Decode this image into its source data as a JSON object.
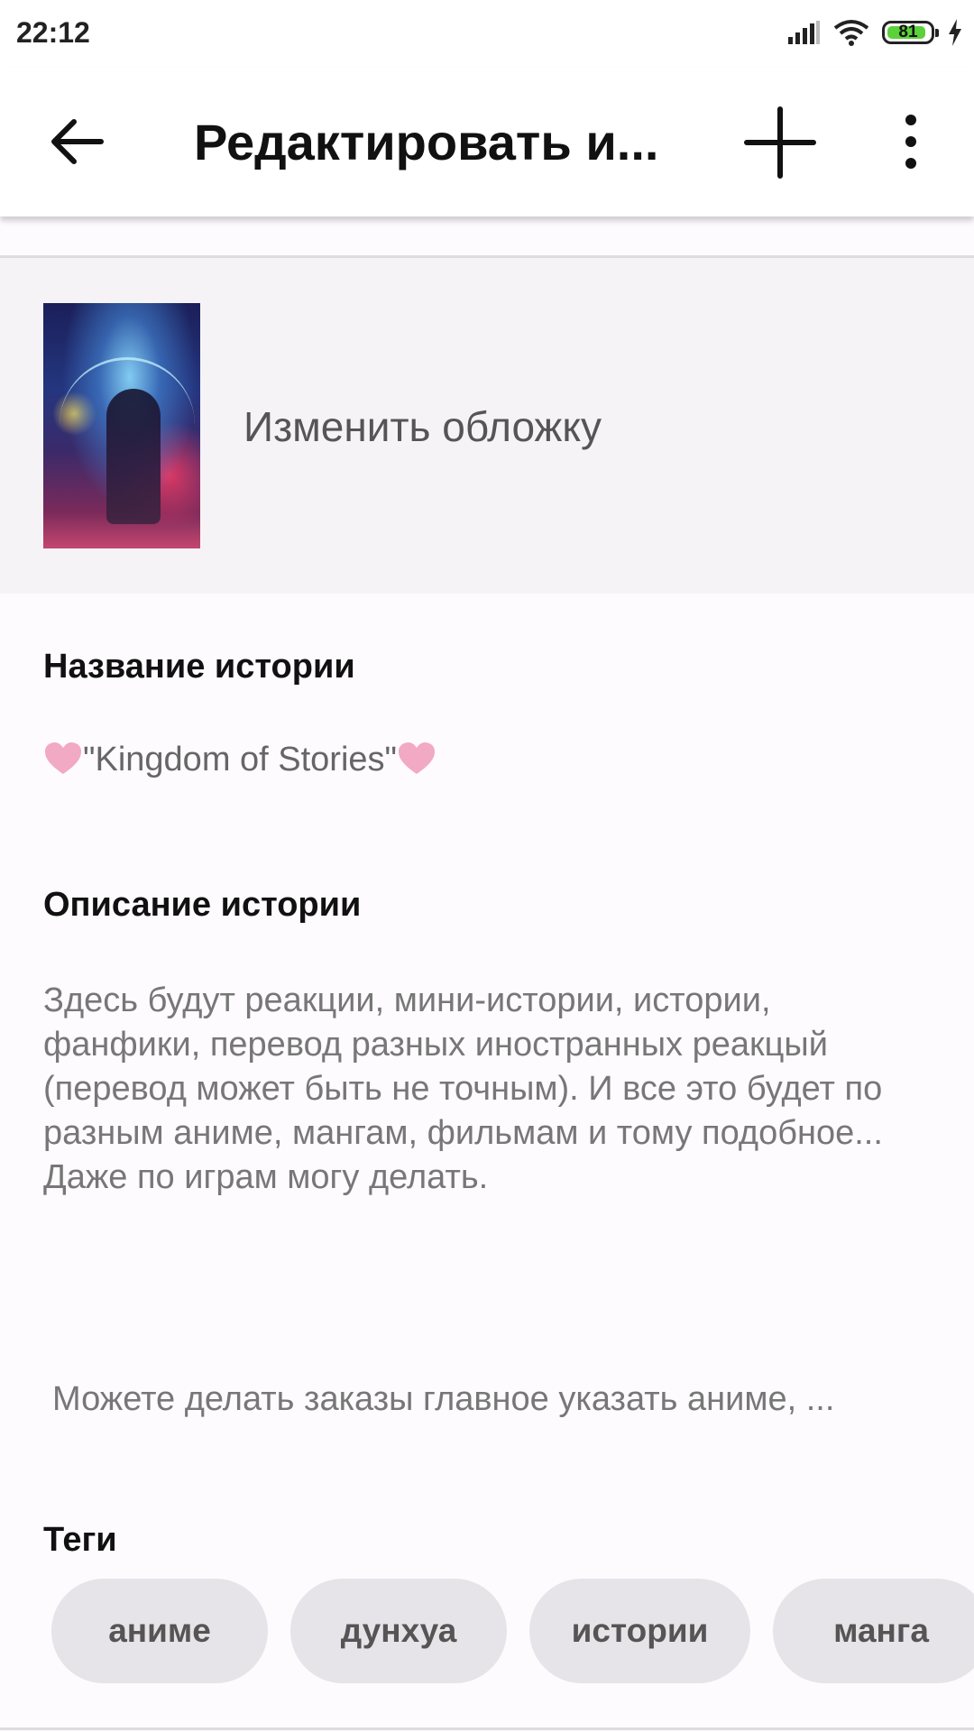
{
  "status_bar": {
    "time": "22:12",
    "battery": "81"
  },
  "app_bar": {
    "title": "Редактировать и..."
  },
  "cover": {
    "change_label": "Изменить обложку"
  },
  "story": {
    "title_label": "Название истории",
    "title_value": "\"Kingdom of Stories\"",
    "description_label": "Описание истории",
    "description": "Здесь будут реакции, мини-истории, истории, фанфики, перевод разных иностранных реакцый (перевод может быть не точным). И все это будет по разным аниме, мангам, фильмам и тому подобное... Даже по играм могу делать.",
    "order_line": "Можете делать заказы главное указать аниме, ..."
  },
  "tags": {
    "label": "Теги",
    "items": [
      "аниме",
      "дунхуа",
      "истории",
      "манга"
    ]
  },
  "icons": {
    "back": "arrow-left-icon",
    "add": "plus-icon",
    "more": "more-vert-icon",
    "heart": "heart-icon",
    "heart_color": "#f2a9c4"
  }
}
